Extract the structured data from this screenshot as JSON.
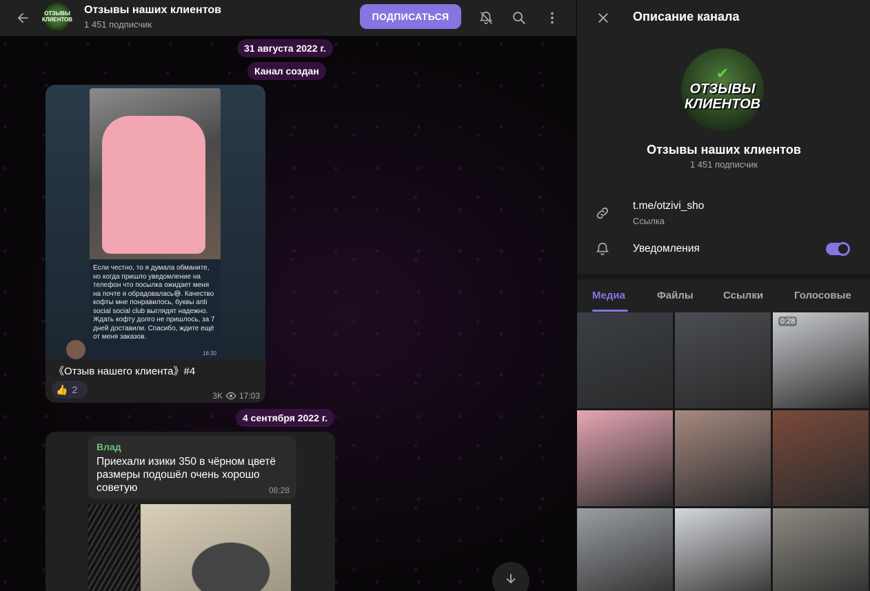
{
  "chat": {
    "title": "Отзывы наших клиентов",
    "subscribers": "1 451 подписчик",
    "subscribe_label": "ПОДПИСАТЬСЯ",
    "avatar_text": "ОТЗЫВЫ КЛИЕНТОВ",
    "date_1": "31 августа 2022 г.",
    "service_msg": "Канал создан",
    "date_2": "4 сентября 2022 г."
  },
  "post1": {
    "review_text": "Если честно, то я думала обманите, но когда пришло уведомление на телефон что посылка ожидает меня на почте я обрадовалась😅. Качество кофты мне понравилось, буквы anti social social club выглядят надежно. Ждать кофту долго не пришлось, за 7 дней доставили. Спасибо, ждите ещё от меня заказов.",
    "review_time": "16:30",
    "caption": "《Отзыв нашего клиента》#4",
    "reaction_emoji": "👍",
    "reaction_count": "2",
    "views": "3K",
    "time": "17:03"
  },
  "post2": {
    "author": "Влад",
    "text": "Приехали изики 350 в чёрном цветё размеры подошёл очень хорошо советую",
    "time": "08:28"
  },
  "panel": {
    "title": "Описание канала",
    "logo_line1": "ОТЗЫВЫ",
    "logo_line2": "КЛИЕНТОВ",
    "channel_name": "Отзывы наших клиентов",
    "subscribers": "1 451 подписчик",
    "link": "t.me/otzivi_sho",
    "link_label": "Ссылка",
    "notifications_label": "Уведомления",
    "notifications_on": true,
    "tabs": [
      "Медиа",
      "Файлы",
      "Ссылки",
      "Голосовые"
    ],
    "active_tab": "Медиа",
    "media": [
      {
        "color": "#3a3f45",
        "duration": ""
      },
      {
        "color": "#4a4d52",
        "duration": ""
      },
      {
        "color": "#c9ccd0",
        "duration": "0:28"
      },
      {
        "color": "#e7a7b4",
        "duration": ""
      },
      {
        "color": "#a78a80",
        "duration": ""
      },
      {
        "color": "#7a4a3a",
        "duration": ""
      },
      {
        "color": "#9a9ea3",
        "duration": ""
      },
      {
        "color": "#d5d8dc",
        "duration": ""
      },
      {
        "color": "#8e8a82",
        "duration": ""
      }
    ]
  },
  "colors": {
    "accent": "#8774e1",
    "header_bg": "#212121",
    "panel_bg": "#181818",
    "author_green": "#6bc27a"
  }
}
